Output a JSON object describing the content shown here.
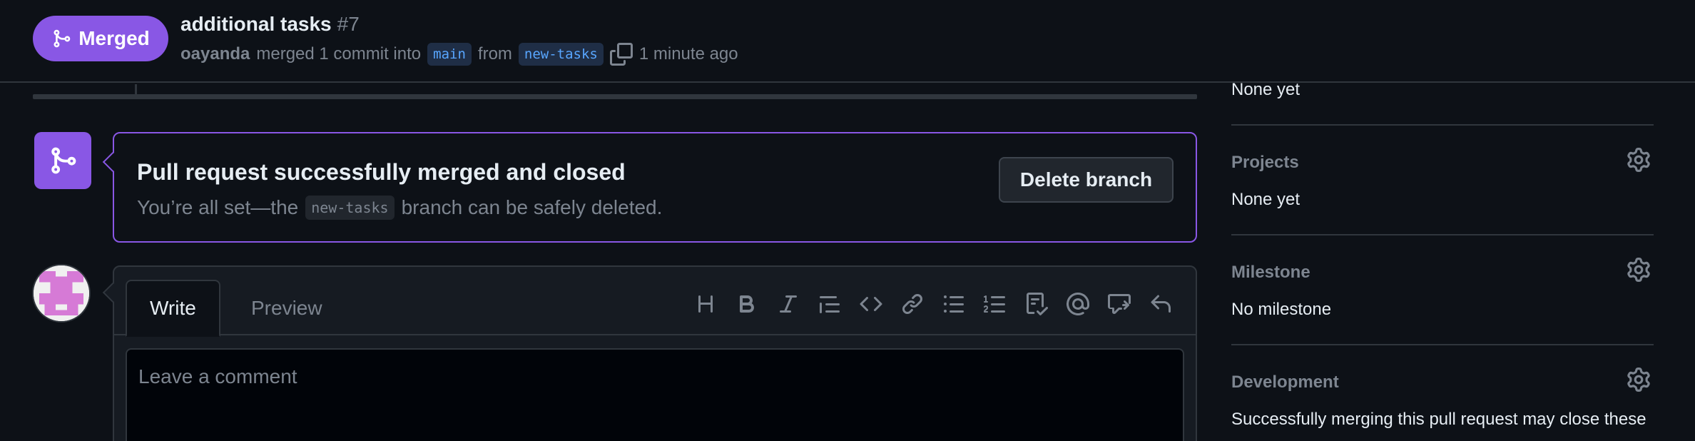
{
  "header": {
    "status_badge": "Merged",
    "title": "additional tasks",
    "number": "#7",
    "author": "oayanda",
    "merge_text": "merged 1 commit into",
    "base_branch": "main",
    "from_text": "from",
    "head_branch": "new-tasks",
    "time": "1 minute ago"
  },
  "merge_box": {
    "title": "Pull request successfully merged and closed",
    "desc_before": "You’re all set—the",
    "branch": "new-tasks",
    "desc_after": "branch can be safely deleted.",
    "delete_button": "Delete branch"
  },
  "comment": {
    "tabs": [
      "Write",
      "Preview"
    ],
    "placeholder": "Leave a comment",
    "toolbar_icons": [
      "heading-icon",
      "bold-icon",
      "italic-icon",
      "quote-icon",
      "code-icon",
      "link-icon",
      "unordered-list-icon",
      "ordered-list-icon",
      "task-list-icon",
      "mention-icon",
      "reference-icon",
      "saved-reply-icon"
    ]
  },
  "sidebar": {
    "labels_value": "None yet",
    "projects_heading": "Projects",
    "projects_value": "None yet",
    "milestone_heading": "Milestone",
    "milestone_value": "No milestone",
    "development_heading": "Development",
    "development_text": "Successfully merging this pull request may close these"
  },
  "colors": {
    "merged_purple": "#8957e5",
    "background": "#0d1117",
    "link_blue": "#58a6ff"
  }
}
